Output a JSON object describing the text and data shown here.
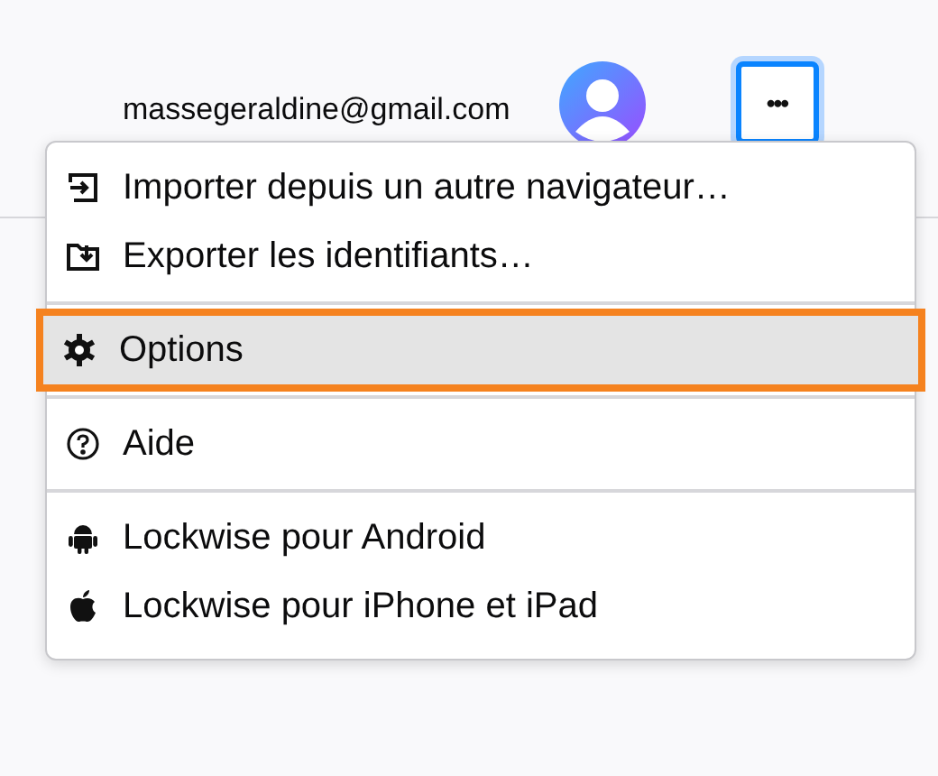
{
  "header": {
    "account_email": "massegeraldine@gmail.com",
    "menu_button": {
      "label": "•••",
      "focused": true
    }
  },
  "menu": {
    "sections": [
      {
        "items": [
          {
            "label": "Importer depuis un autre navigateur…",
            "selected": false
          },
          {
            "label": "Exporter les identifiants…",
            "selected": false
          }
        ]
      },
      {
        "items": [
          {
            "label": "Options",
            "selected": true
          }
        ]
      },
      {
        "items": [
          {
            "label": "Aide",
            "selected": false
          }
        ]
      },
      {
        "items": [
          {
            "label": "Lockwise pour Android",
            "selected": false
          },
          {
            "label": "Lockwise pour iPhone et iPad",
            "selected": false
          }
        ]
      }
    ]
  }
}
